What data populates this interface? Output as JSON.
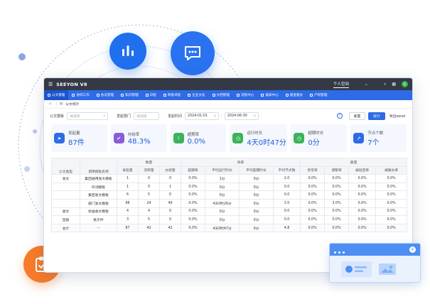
{
  "titlebar": {
    "brand": "SEEYON V8",
    "space": "个人空间",
    "avatar": "G"
  },
  "nav": {
    "items": [
      "公文管理",
      "协同工作",
      "会议管理",
      "知识管理",
      "日程",
      "审批日程",
      "企业文化",
      "文档管理",
      "流程中心",
      "报表中心",
      "督查督办",
      "产权管理"
    ],
    "active_index": 0
  },
  "breadcrumb": {
    "current": "公文统计"
  },
  "filters": {
    "template_label": "公文模板",
    "template_placeholder": "请选择",
    "dept_label": "发起部门",
    "dept_placeholder": "请选择",
    "time_label": "发起时间",
    "start_date": "2024-01-01",
    "end_date": "2024-06-30",
    "reset_label": "重置",
    "stat_label": "统计",
    "export_label": "导出excel"
  },
  "cards": [
    {
      "title": "发起量",
      "value": "87件",
      "icon": "send-icon",
      "color": "#2f6be6"
    },
    {
      "title": "办结率",
      "value": "48.3%",
      "icon": "check-icon",
      "color": "#8c5bd8"
    },
    {
      "title": "超期率",
      "value": "0.0%",
      "icon": "info-icon",
      "color": "#3bb35a"
    },
    {
      "title": "运行时长",
      "value": "4天0时47分",
      "icon": "clock-icon",
      "color": "#3bb35a"
    },
    {
      "title": "超期时长",
      "value": "0分",
      "icon": "clock-icon",
      "color": "#3bb35a"
    },
    {
      "title": "节点个数",
      "value": "7个",
      "icon": "trend-icon",
      "color": "#2f6be6"
    }
  ],
  "table": {
    "group_headers": {
      "qty": "数量",
      "efficiency": "效率",
      "quality": "质量"
    },
    "headers": [
      "公文类型",
      "调用模板名称",
      "发起量",
      "流转量",
      "办结量",
      "超期率",
      "平均运行时长",
      "平均超期时长",
      "平均节点数",
      "异常率",
      "调整率",
      "被退回率",
      "被撤办率"
    ],
    "rows": [
      [
        "发文",
        "集团通用发文模板",
        "1",
        "0",
        "0",
        "0.0%",
        "1分",
        "0分",
        "2.0",
        "0.0%",
        "0.0%",
        "0.0%",
        "0.0%"
      ],
      [
        "",
        "作词模板",
        "1",
        "0",
        "1",
        "0.0%",
        "0分",
        "0分",
        "0.0",
        "0.0%",
        "0.0%",
        "0.0%",
        "0.0%"
      ],
      [
        "",
        "集团发文模板",
        "6",
        "5",
        "0",
        "0.0%",
        "0分",
        "0分",
        "0.0",
        "0.0%",
        "0.0%",
        "0.0%",
        "0.0%"
      ],
      [
        "",
        "部门发文模板",
        "66",
        "24",
        "40",
        "0.0%",
        "4天0时26分",
        "0分",
        "3.0",
        "0.0%",
        "3.0%",
        "0.0%",
        "0.0%"
      ],
      [
        "收文",
        "标准收文模板",
        "4",
        "4",
        "0",
        "0.0%",
        "0分",
        "0分",
        "0.0",
        "0.0%",
        "0.0%",
        "0.0%",
        "0.0%"
      ],
      [
        "签报",
        "批示件",
        "3",
        "5",
        "0",
        "0.0%",
        "0分",
        "0分",
        "0.0",
        "0.0%",
        "0.0%",
        "0.0%",
        "0.0%"
      ]
    ],
    "total": [
      "总计",
      "--",
      "87",
      "42",
      "42",
      "0.0%",
      "4天0时47分",
      "0分",
      "4.8",
      "0.0%",
      "0.0%",
      "0.0%",
      "0.0%"
    ]
  }
}
